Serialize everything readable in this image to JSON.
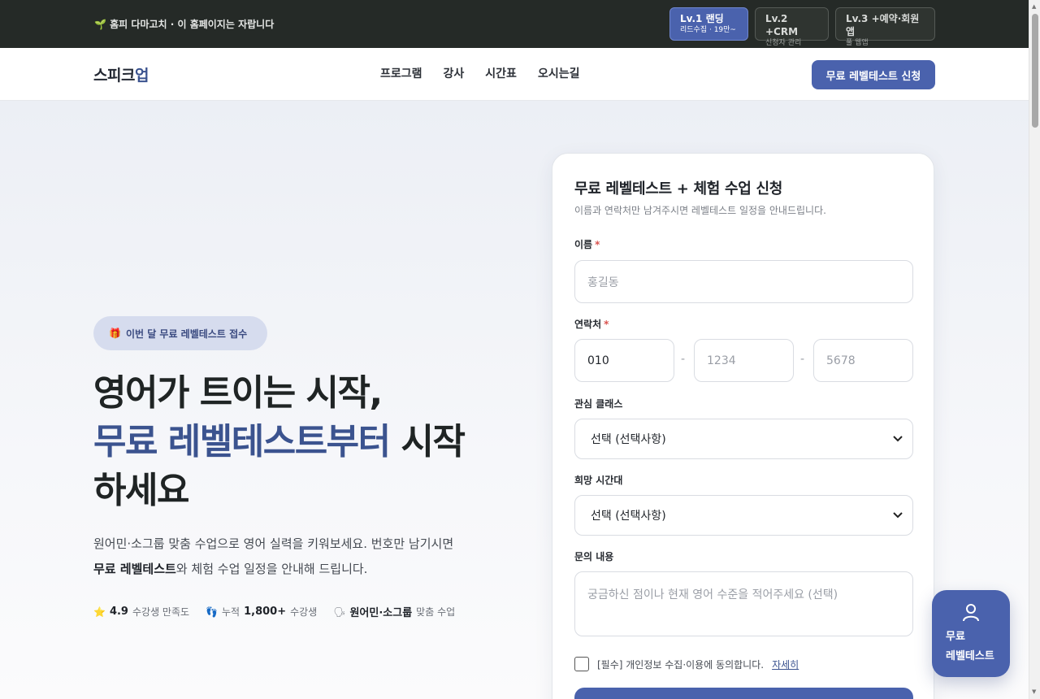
{
  "topbar": {
    "notice_icon": "seedling-icon",
    "notice": "홈피 다마고치 · 이 홈페이지는 자랍니다",
    "levels": [
      {
        "title": "Lv.1 랜딩",
        "sub": "리드수집 · 19만~"
      },
      {
        "title": "Lv.2 +CRM",
        "sub": "신청자 관리"
      },
      {
        "title": "Lv.3 +예약·회원앱",
        "sub": "풀 웹앱"
      }
    ]
  },
  "header": {
    "logo_main": "스피크",
    "logo_accent": "업",
    "nav": [
      "프로그램",
      "강사",
      "시간표",
      "오시는길"
    ],
    "cta": "무료 레벨테스트 신청"
  },
  "hero": {
    "pill_icon": "gift-icon",
    "pill": "이번 달 무료 레벨테스트 접수",
    "headline_line1": "영어가 트이는 시작,",
    "headline_blue": "무료 레벨테스트부터",
    "headline_after_blue": " 시작",
    "headline_line3": "하세요",
    "desc_line1": "원어민·소그룹 맞춤 수업으로 영어 실력을 키워보세요. 번호만 남기시면",
    "desc_bold": "무료 레벨테스트",
    "desc_rest": "와 체험 수업 일정을 안내해 드립니다.",
    "stats": [
      {
        "icon": "star-icon",
        "bold": "4.9",
        "text": "수강생 만족도"
      },
      {
        "icon": "footprints-icon",
        "prefix": "누적",
        "bold": "1,800+",
        "text": "수강생"
      },
      {
        "icon": "speaking-head-icon",
        "bold": "원어민·소그룹",
        "text": "맞춤 수업"
      }
    ]
  },
  "form": {
    "title": "무료 레벨테스트 + 체험 수업 신청",
    "subtitle": "이름과 연락처만 남겨주시면 레벨테스트 일정을 안내드립니다.",
    "name_label": "이름",
    "required_mark": "*",
    "name_placeholder": "홍길동",
    "phone_label": "연락처",
    "phone_1": "010",
    "phone_2_placeholder": "1234",
    "phone_3_placeholder": "5678",
    "phone_dash": "-",
    "class_label": "관심 클래스",
    "class_value": "선택 (선택사항)",
    "time_label": "희망 시간대",
    "time_value": "선택 (선택사항)",
    "inquiry_label": "문의 내용",
    "inquiry_placeholder": "궁금하신 점이나 현재 영어 수준을 적어주세요 (선택)",
    "agree_text": "[필수] 개인정보 수집·이용에 동의합니다.",
    "agree_link": "자세히"
  },
  "fab": {
    "icon": "person-icon",
    "line1": "무료",
    "line2": "레벨테스트"
  },
  "colors": {
    "brand": "#4a62ad",
    "accent_text": "#3b538f",
    "topbar": "#252a27"
  }
}
